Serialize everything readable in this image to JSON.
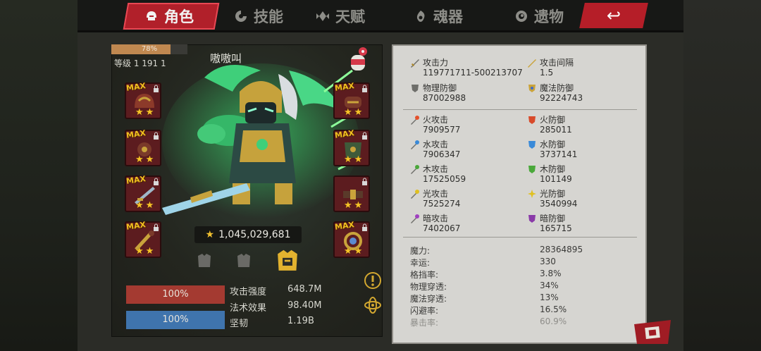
{
  "tabs": [
    {
      "label": "角色",
      "icon": "helmet-icon",
      "active": true
    },
    {
      "label": "技能",
      "icon": "swirl-icon",
      "active": false
    },
    {
      "label": "天赋",
      "icon": "diamond-wings-icon",
      "active": false
    },
    {
      "label": "魂器",
      "icon": "soul-flame-icon",
      "active": false
    },
    {
      "label": "遗物",
      "icon": "spiral-icon",
      "active": false
    }
  ],
  "back_icon": "back-arrow-icon",
  "character": {
    "exp_percent_text": "78%",
    "exp_fraction": 0.78,
    "level_text": "等级 1  191 1",
    "name": "嗷嗷叫",
    "power": "1,045,029,681"
  },
  "slots": {
    "max_label": "MAX"
  },
  "bars": {
    "red_text": "100%",
    "blue_text": "100%"
  },
  "stats": [
    {
      "label": "攻击强度",
      "value": "648.7M"
    },
    {
      "label": "法术效果",
      "value": "98.40M"
    },
    {
      "label": "坚韧",
      "value": "1.19B"
    }
  ],
  "attributes": {
    "attack": {
      "label": "攻击力",
      "value": "119771711-500213707",
      "icon": "sword-icon"
    },
    "attack_interval": {
      "label": "攻击间隔",
      "value": "1.5",
      "icon": "hourglass-sword-icon"
    },
    "phys_def": {
      "label": "物理防御",
      "value": "87002988",
      "icon": "shield-icon"
    },
    "magic_def": {
      "label": "魔法防御",
      "value": "92224743",
      "icon": "magic-shield-icon"
    },
    "fire_atk": {
      "label": "火攻击",
      "value": "7909577",
      "icon": "fire-sword-icon"
    },
    "fire_def": {
      "label": "火防御",
      "value": "285011",
      "icon": "fire-shield-icon"
    },
    "water_atk": {
      "label": "水攻击",
      "value": "7906347",
      "icon": "water-sword-icon"
    },
    "water_def": {
      "label": "水防御",
      "value": "3737141",
      "icon": "water-shield-icon"
    },
    "wood_atk": {
      "label": "木攻击",
      "value": "17525059",
      "icon": "wood-sword-icon"
    },
    "wood_def": {
      "label": "木防御",
      "value": "101149",
      "icon": "wood-shield-icon"
    },
    "light_atk": {
      "label": "光攻击",
      "value": "7525274",
      "icon": "light-sword-icon"
    },
    "light_def": {
      "label": "光防御",
      "value": "3540994",
      "icon": "light-shield-icon"
    },
    "dark_atk": {
      "label": "暗攻击",
      "value": "7402067",
      "icon": "dark-sword-icon"
    },
    "dark_def": {
      "label": "暗防御",
      "value": "165715",
      "icon": "dark-shield-icon"
    }
  },
  "properties": [
    {
      "label": "魔力:",
      "value": "28364895"
    },
    {
      "label": "幸运:",
      "value": "330"
    },
    {
      "label": "格挡率:",
      "value": "3.8%"
    },
    {
      "label": "物理穿透:",
      "value": "34%"
    },
    {
      "label": "魔法穿透:",
      "value": "13%"
    },
    {
      "label": "闪避率:",
      "value": "16.5%"
    },
    {
      "label": "暴击率:",
      "value": "60.9%"
    }
  ],
  "colors": {
    "accent_red": "#b1202a",
    "panel_bg": "#d6d5d1",
    "star": "#f6c328",
    "hp_red": "#a43a31",
    "mp_blue": "#3f74ad"
  }
}
